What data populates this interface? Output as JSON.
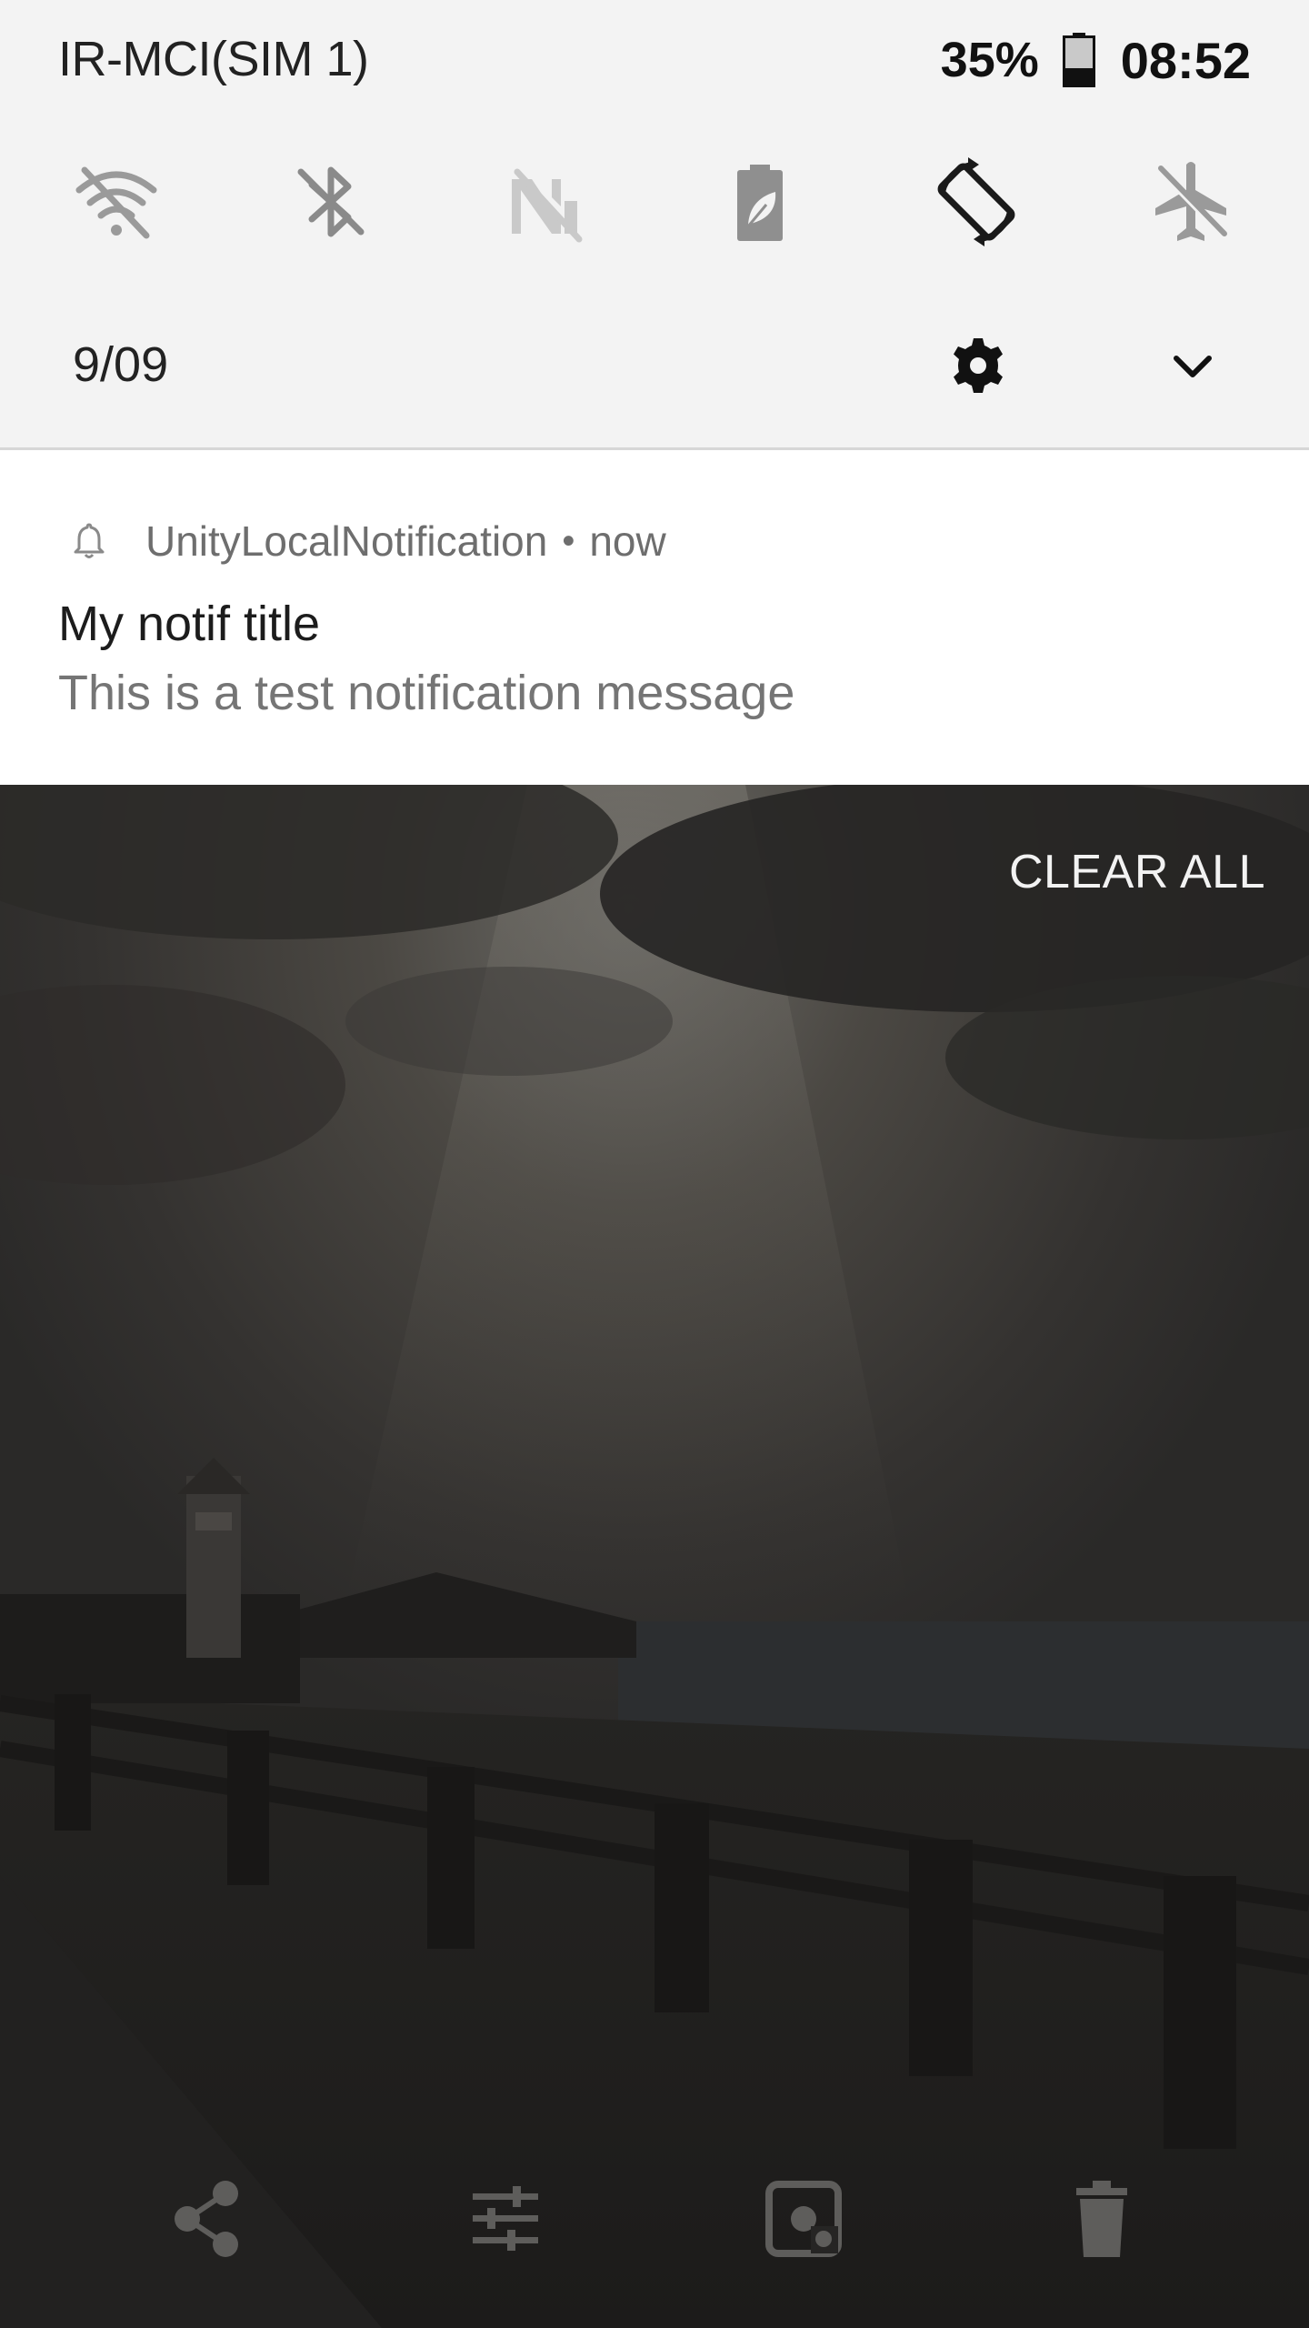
{
  "status_bar": {
    "carrier": "IR-MCI(SIM 1)",
    "battery_percent": "35%",
    "battery_level": 0.35,
    "time": "08:52"
  },
  "quick_tiles": [
    {
      "icon": "wifi-off-icon",
      "active": false
    },
    {
      "icon": "bluetooth-off-icon",
      "active": false
    },
    {
      "icon": "mobile-data-off-icon",
      "active": false
    },
    {
      "icon": "battery-saver-icon",
      "active": false
    },
    {
      "icon": "auto-rotate-icon",
      "active": true
    },
    {
      "icon": "airplane-mode-icon",
      "active": false
    }
  ],
  "qs_footer": {
    "date": "9/09",
    "settings_icon": "gear-icon",
    "expand_icon": "chevron-down-icon"
  },
  "notification": {
    "app_icon": "bell-icon",
    "app_name": "UnityLocalNotification",
    "separator": "•",
    "time": "now",
    "title": "My notif title",
    "text": "This is a test notification message"
  },
  "wallpaper": {
    "clear_all_label": "CLEAR ALL"
  },
  "bottom_actions": [
    {
      "icon": "share-icon"
    },
    {
      "icon": "tune-icon"
    },
    {
      "icon": "screenshot-icon"
    },
    {
      "icon": "trash-icon"
    }
  ],
  "colors": {
    "panel_bg": "#f3f3f3",
    "active_icon": "#1a1a1a",
    "inactive_icon": "#9a9a9a",
    "notification_bg": "#ffffff"
  }
}
